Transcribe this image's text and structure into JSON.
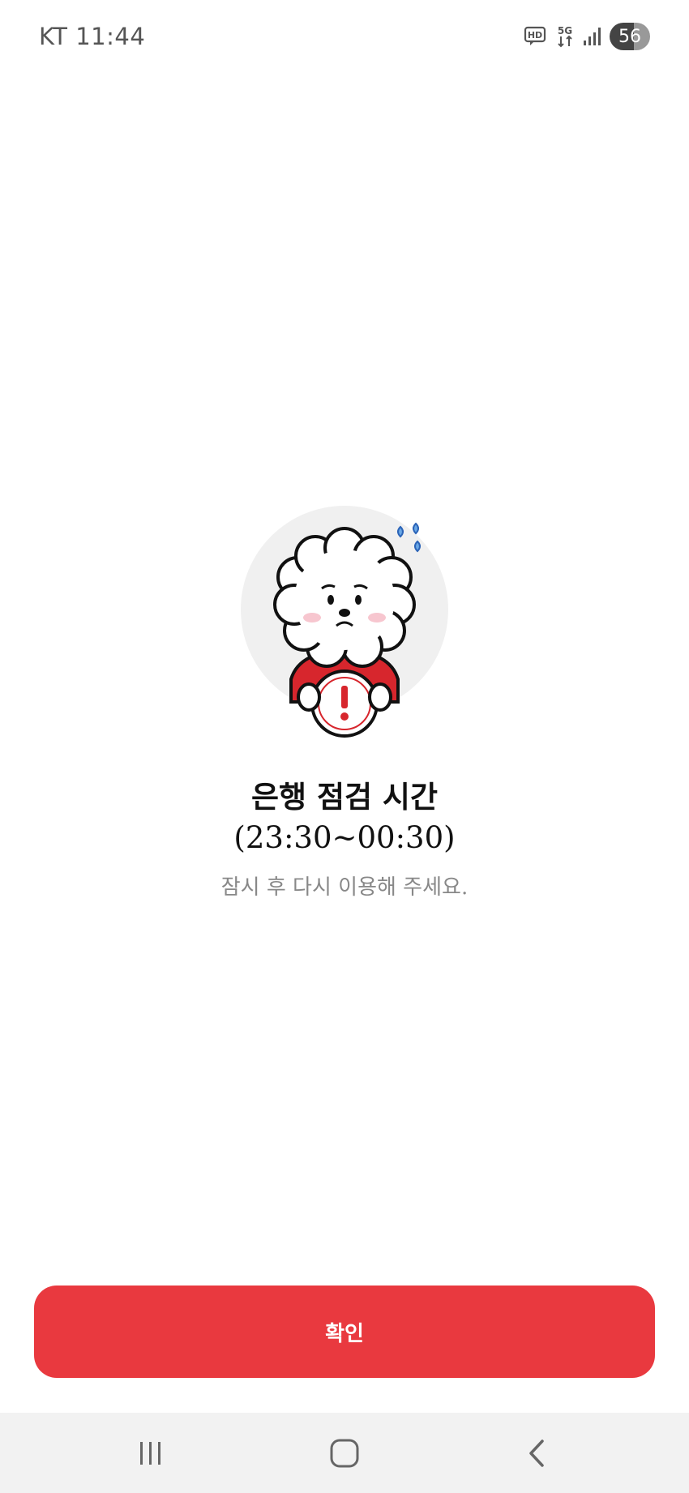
{
  "status_bar": {
    "carrier_time": "KT 11:44",
    "icons": [
      "hd-voice-icon",
      "5g-data-icon",
      "signal-icon"
    ],
    "battery": "56"
  },
  "notice": {
    "title": "은행 점검 시간",
    "time_range": "(23:30~00:30)",
    "subtitle": "잠시 후 다시 이용해 주세요."
  },
  "confirm_button": {
    "label": "확인"
  },
  "nav_bar": {
    "buttons": [
      "recent-apps-icon",
      "home-icon",
      "back-icon"
    ]
  },
  "colors": {
    "accent": "#e9393f",
    "nav_background": "#f2f2f2",
    "text_primary": "#111111",
    "text_secondary": "#888888"
  }
}
